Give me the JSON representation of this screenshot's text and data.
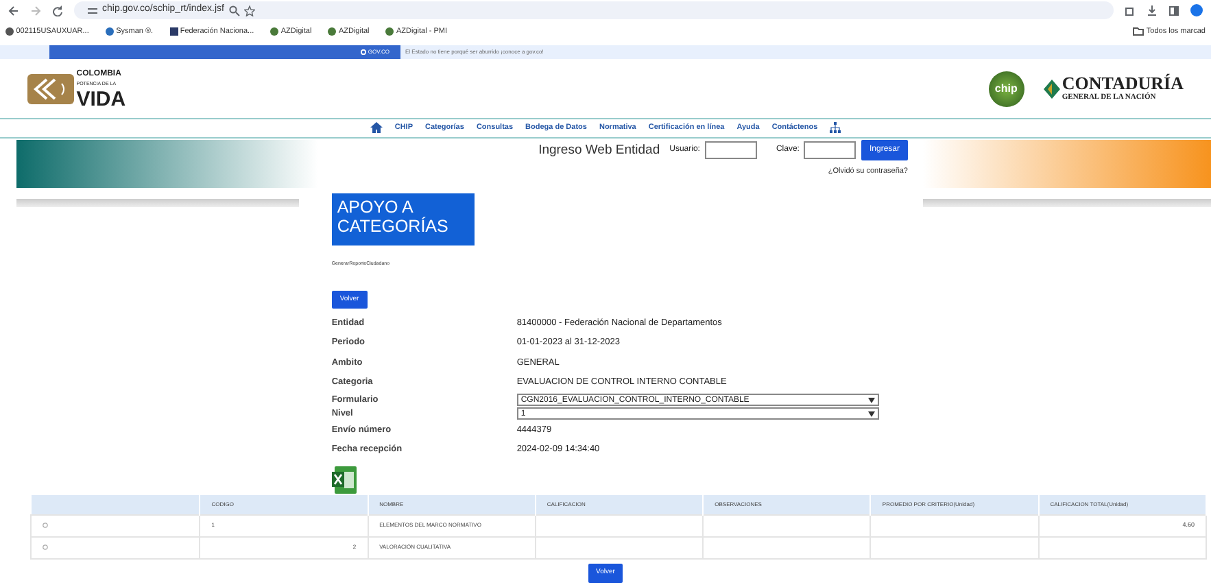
{
  "browser": {
    "url": "chip.gov.co/schip_rt/index.jsf",
    "bookmarks": [
      "002115USAUXUAR...",
      "Sysman ®.",
      "Federación Naciona...",
      "AZDigital",
      "AZDigital",
      "AZDigital - PMI"
    ],
    "all_bookmarks": "Todos los marcad"
  },
  "gov_bar": {
    "brand": "GOV.CO",
    "message": "El Estado no tiene porqué ser aburrido ¡conoce a gov.co!"
  },
  "header": {
    "left_logo": {
      "line1": "COLOMBIA",
      "line2": "POTENCIA DE LA",
      "line3": "VIDA"
    },
    "chip_logo": "chip",
    "right_logo": {
      "line1": "CONTADURÍA",
      "line2": "GENERAL DE LA NACIÓN"
    }
  },
  "nav": [
    "CHIP",
    "Categorías",
    "Consultas",
    "Bodega de Datos",
    "Normativa",
    "Certificación en línea",
    "Ayuda",
    "Contáctenos"
  ],
  "login": {
    "title": "Ingreso Web Entidad",
    "user_label": "Usuario:",
    "password_label": "Clave:",
    "button": "Ingresar",
    "forgot": "¿Olvidó su contraseña?"
  },
  "page_title": "APOYO A CATEGORÍAS",
  "report_name": "GenerarReporteCiudadano",
  "back_button": "Volver",
  "fields": [
    {
      "kind": "text",
      "label": "Entidad",
      "value": "81400000 - Federación Nacional de Departamentos"
    },
    {
      "kind": "text",
      "label": "Periodo",
      "value": "01-01-2023 al 31-12-2023"
    },
    {
      "kind": "text",
      "label": "Ambito",
      "value": "GENERAL"
    },
    {
      "kind": "text",
      "label": "Categoria",
      "value": "EVALUACION DE CONTROL INTERNO CONTABLE"
    },
    {
      "kind": "select",
      "label": "Formulario",
      "value": "CGN2016_EVALUACION_CONTROL_INTERNO_CONTABLE"
    },
    {
      "kind": "select",
      "label": "Nivel",
      "value": "1"
    },
    {
      "kind": "text",
      "label": "Envío número",
      "value": "4444379"
    },
    {
      "kind": "text",
      "label": "Fecha recepción",
      "value": "2024-02-09 14:34:40"
    }
  ],
  "table": {
    "columns": [
      "CODIGO",
      "NOMBRE",
      "CALIFICACION",
      "OBSERVACIONES",
      "PROMEDIO POR CRITERIO(Unidad)",
      "CALIFICACION TOTAL(Unidad)"
    ],
    "rows": [
      {
        "kind": "criterion",
        "codigo": "1",
        "nombre": "ELEMENTOS DEL MARCO NORMATIVO",
        "total": "4.60"
      },
      {
        "kind": "qualitative",
        "codigo": "2",
        "nombre": "VALORACIÓN CUALITATIVA"
      }
    ]
  },
  "bottom_button": "Volver"
}
